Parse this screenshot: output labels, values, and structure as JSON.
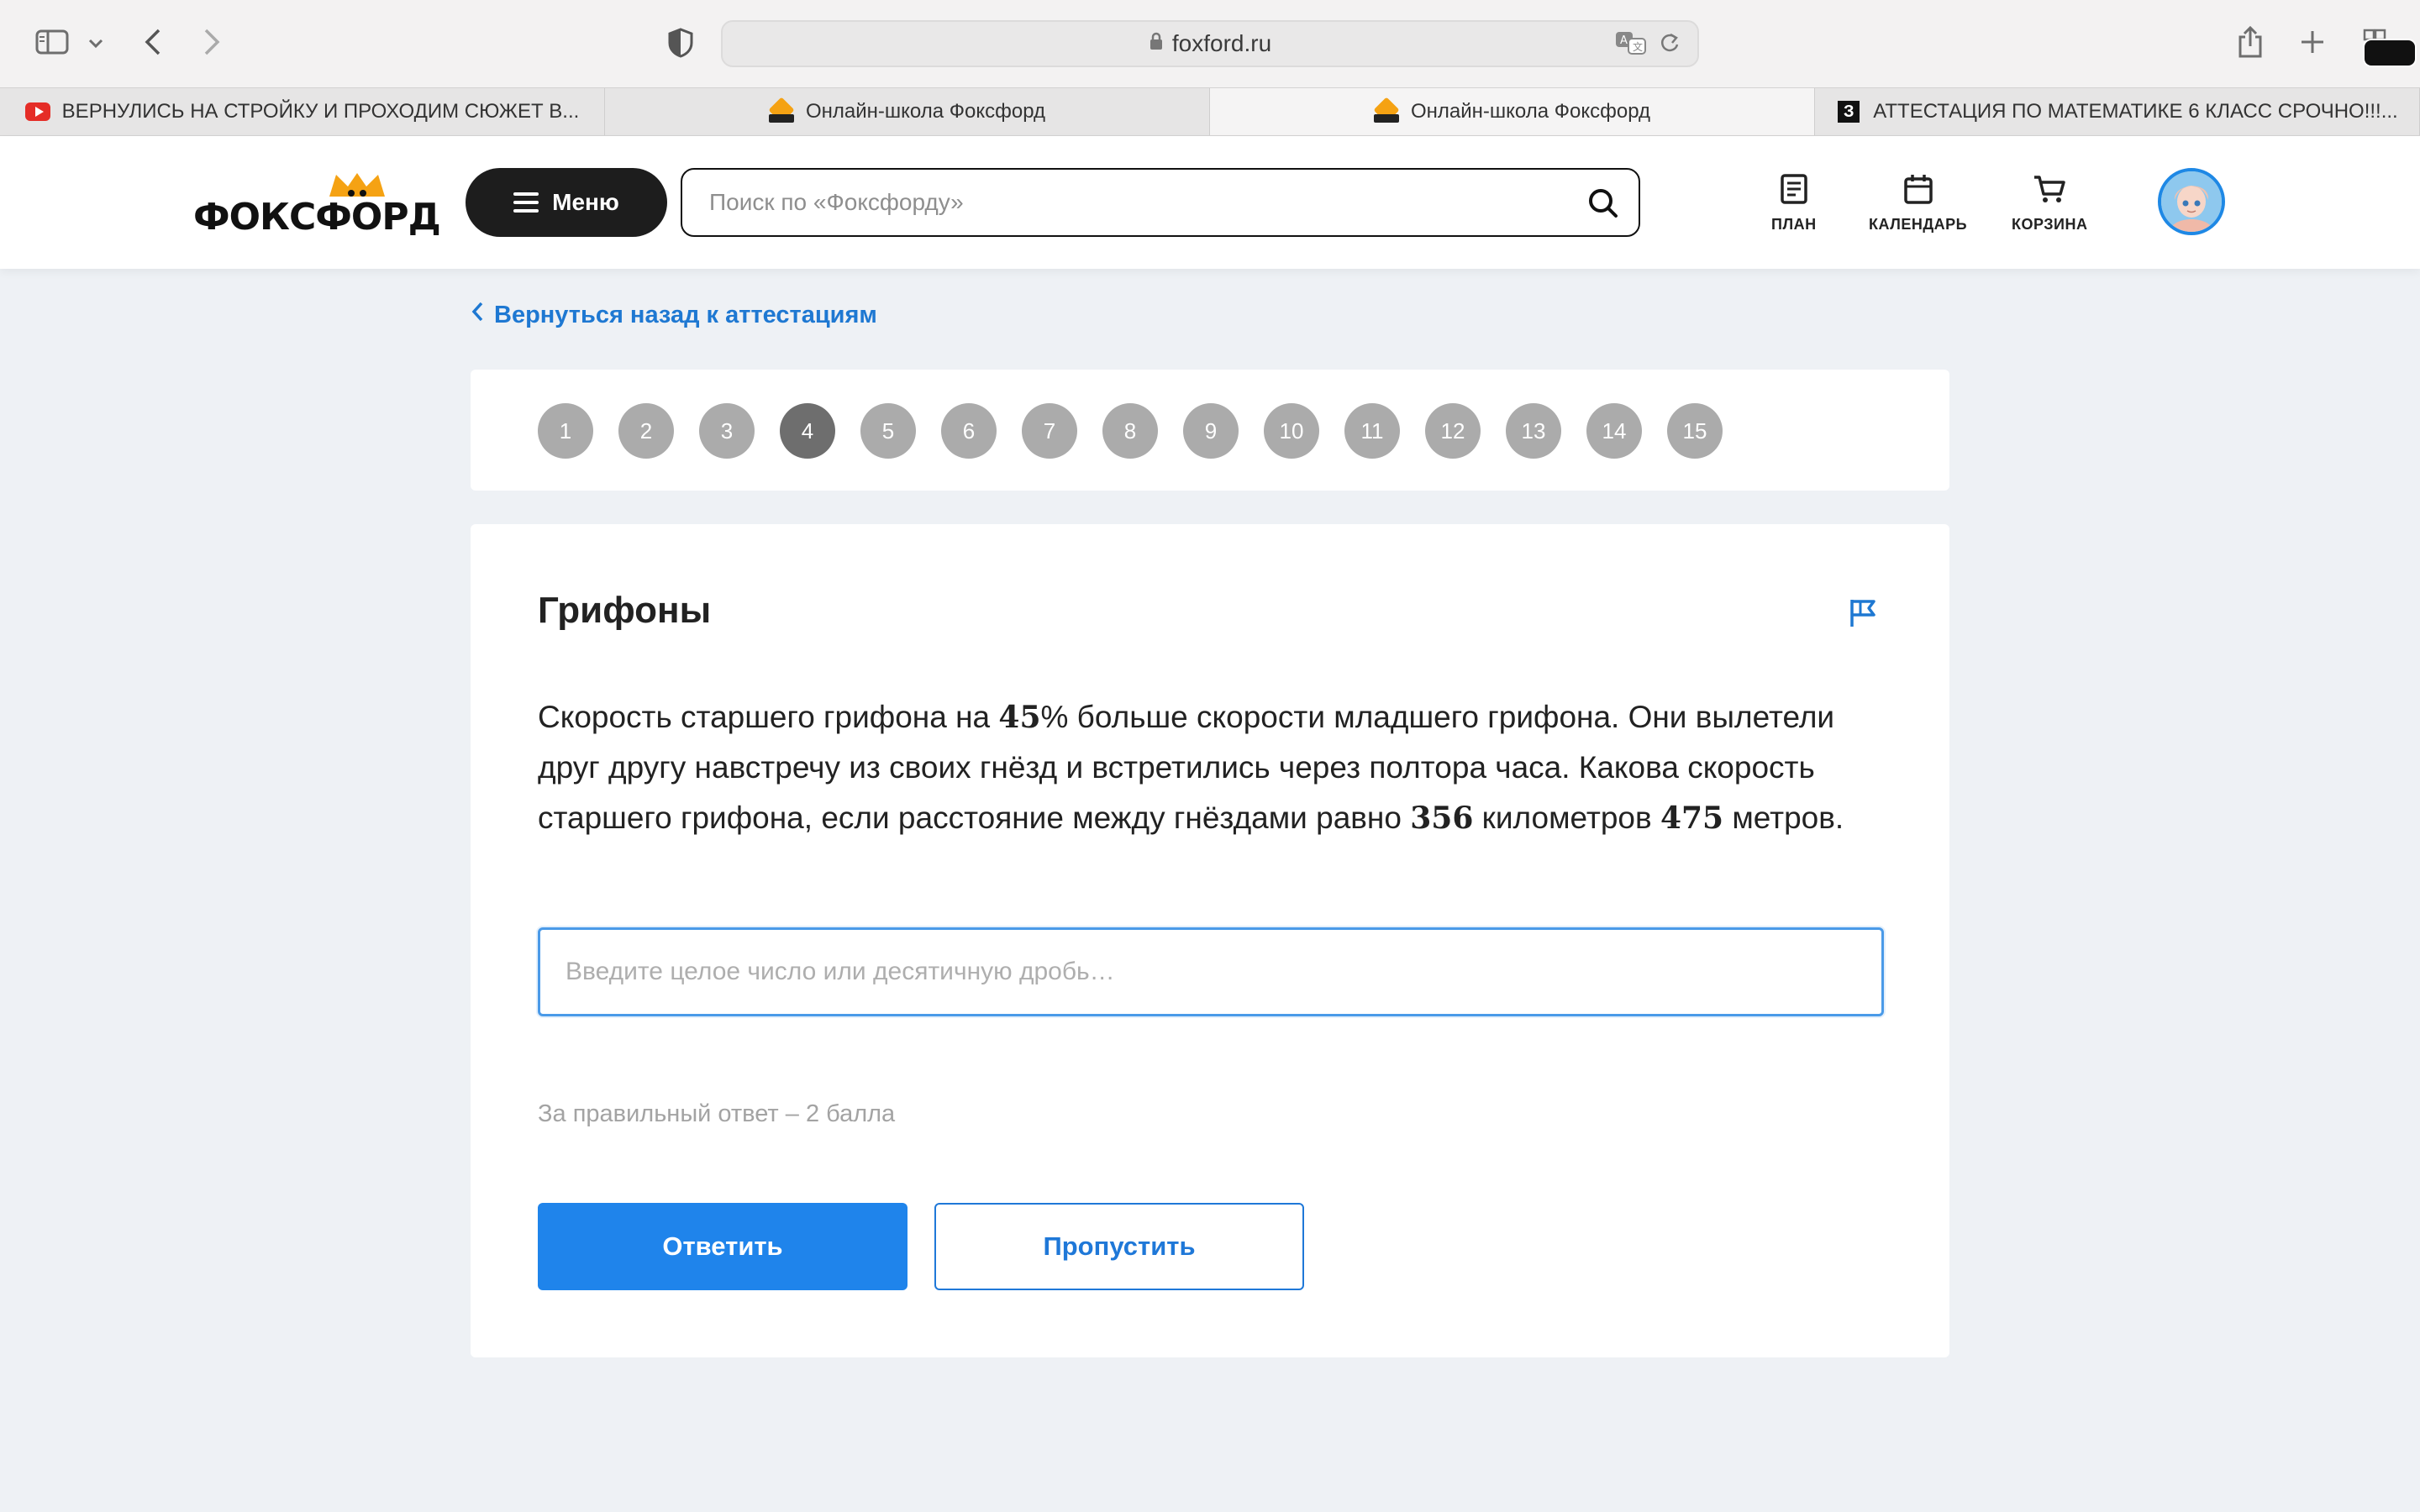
{
  "browser": {
    "url": "foxford.ru",
    "tabs": [
      {
        "title": "ВЕРНУЛИСЬ НА СТРОЙКУ И ПРОХОДИМ СЮЖЕТ В...",
        "icon": "youtube-icon"
      },
      {
        "title": "Онлайн-школа Фоксфорд",
        "icon": "foxford-icon"
      },
      {
        "title": "Онлайн-школа Фоксфорд",
        "icon": "foxford-icon"
      },
      {
        "title": "АТТЕСТАЦИЯ ПО МАТЕМАТИКЕ 6 КЛАСС СРОЧНО!!!...",
        "icon": "z-icon"
      }
    ],
    "active_tab": 2
  },
  "header": {
    "logo_text": "ФОКСФОРД",
    "menu_label": "Меню",
    "search_placeholder": "Поиск по «Фоксфорду»",
    "nav": [
      {
        "label": "ПЛАН",
        "icon": "plan-icon"
      },
      {
        "label": "КАЛЕНДАРЬ",
        "icon": "calendar-icon"
      },
      {
        "label": "КОРЗИНА",
        "icon": "cart-icon"
      }
    ]
  },
  "back_link": "Вернуться назад к аттестациям",
  "questions": [
    "1",
    "2",
    "3",
    "4",
    "5",
    "6",
    "7",
    "8",
    "9",
    "10",
    "11",
    "12",
    "13",
    "14",
    "15"
  ],
  "current_question": 4,
  "task": {
    "title": "Грифоны",
    "text_1": "Скорость старшего грифона на ",
    "pct": "45",
    "text_2": "% больше скорости младшего грифона. Они вылетели друг другу навстречу из своих гнёзд и встретились через полтора часа. Какова скорость старшего грифона, если расстояние между гнёздами равно ",
    "km": "356",
    "text_3": " километров ",
    "m": "475",
    "text_4": " метров.",
    "input_placeholder": "Введите целое число или десятичную дробь…",
    "input_value": "",
    "points_text": "За правильный ответ – 2 балла",
    "answer_label": "Ответить",
    "skip_label": "Пропустить"
  },
  "colors": {
    "accent": "#1f84eb",
    "link": "#1e78d2",
    "brand_orange": "#f5a213",
    "page_bg": "#eef1f5"
  }
}
